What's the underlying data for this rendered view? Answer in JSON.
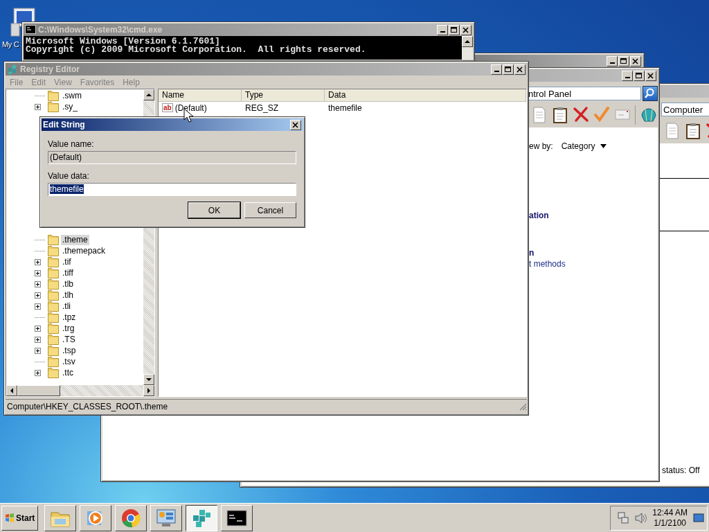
{
  "desktop_icons": [
    {
      "label": "My C"
    }
  ],
  "explorer_window": {
    "address": "Computer",
    "status": "status: Off",
    "active": false
  },
  "control_panel_window": {
    "address": "ntrol Panel",
    "view_by_label": "ew by:",
    "view_by_value": "Category",
    "active": false,
    "items": [
      {
        "text": "ation",
        "kind": "heading"
      },
      {
        "text": "n",
        "kind": "heading"
      },
      {
        "text": "t methods",
        "kind": "link"
      }
    ]
  },
  "cmd_window": {
    "title": "C:\\Windows\\System32\\cmd.exe",
    "active": false,
    "lines": [
      "Microsoft Windows [Version 6.1.7601]",
      "Copyright (c) 2009 Microsoft Corporation.  All rights reserved."
    ]
  },
  "registry_editor": {
    "title": "Registry Editor",
    "active": false,
    "menu": [
      "File",
      "Edit",
      "View",
      "Favorites",
      "Help"
    ],
    "tree_top": [
      {
        "label": ".swm",
        "expandable": false,
        "selected": false
      },
      {
        "label": ".sy_",
        "expandable": true,
        "selected": false
      }
    ],
    "tree_bottom": [
      {
        "label": ".theme",
        "expandable": false,
        "selected": true
      },
      {
        "label": ".themepack",
        "expandable": false,
        "selected": false
      },
      {
        "label": ".tif",
        "expandable": true,
        "selected": false
      },
      {
        "label": ".tiff",
        "expandable": true,
        "selected": false
      },
      {
        "label": ".tlb",
        "expandable": true,
        "selected": false
      },
      {
        "label": ".tlh",
        "expandable": true,
        "selected": false
      },
      {
        "label": ".tli",
        "expandable": true,
        "selected": false
      },
      {
        "label": ".tpz",
        "expandable": false,
        "selected": false
      },
      {
        "label": ".trg",
        "expandable": true,
        "selected": false
      },
      {
        "label": ".TS",
        "expandable": true,
        "selected": false
      },
      {
        "label": ".tsp",
        "expandable": true,
        "selected": false
      },
      {
        "label": ".tsv",
        "expandable": false,
        "selected": false
      },
      {
        "label": ".ttc",
        "expandable": true,
        "selected": false
      }
    ],
    "columns": [
      "Name",
      "Type",
      "Data"
    ],
    "rows": [
      {
        "type_icon": "ab",
        "name": "(Default)",
        "type": "REG_SZ",
        "data": "themefile"
      }
    ],
    "status_bar": "Computer\\HKEY_CLASSES_ROOT\\.theme"
  },
  "edit_string_dialog": {
    "title": "Edit String",
    "active": true,
    "value_name_label": "Value name:",
    "value_name": "(Default)",
    "value_data_label": "Value data:",
    "value_data": "themefile",
    "value_data_selected": true,
    "buttons": [
      {
        "label": "OK",
        "default": true
      },
      {
        "label": "Cancel",
        "default": false
      }
    ]
  },
  "taskbar": {
    "start_label": "Start",
    "apps": [
      {
        "kind": "folder",
        "selected": false
      },
      {
        "kind": "media",
        "selected": false
      },
      {
        "kind": "browser",
        "selected": false
      },
      {
        "kind": "panel",
        "selected": false
      },
      {
        "kind": "registry",
        "selected": true
      },
      {
        "kind": "console",
        "selected": false
      }
    ],
    "clock_time": "12:44 AM",
    "clock_date": "1/1/2100"
  }
}
